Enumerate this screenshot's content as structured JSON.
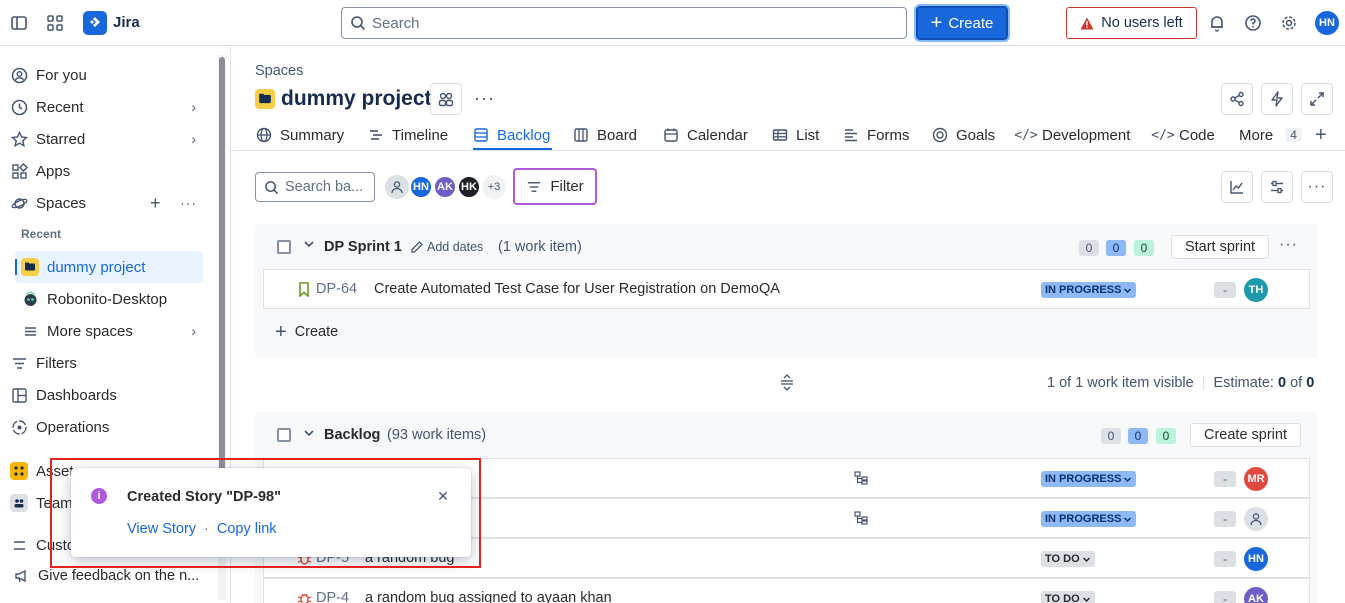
{
  "topbar": {
    "app_name": "Jira",
    "search_placeholder": "Search",
    "create_label": "Create",
    "no_users_label": "No users left",
    "user_initials": "HN"
  },
  "sidebar": {
    "items": [
      {
        "label": "For you",
        "icon": "person-circle-icon"
      },
      {
        "label": "Recent",
        "icon": "clock-icon"
      },
      {
        "label": "Starred",
        "icon": "star-icon"
      },
      {
        "label": "Apps",
        "icon": "apps-icon"
      },
      {
        "label": "Spaces",
        "icon": "planet-icon"
      },
      {
        "label": "Filters",
        "icon": "filter-icon"
      },
      {
        "label": "Dashboards",
        "icon": "dashboard-icon"
      },
      {
        "label": "Operations",
        "icon": "operations-icon"
      }
    ],
    "recent_label": "Recent",
    "recent_spaces": [
      {
        "label": "dummy project"
      },
      {
        "label": "Robonito-Desktop"
      },
      {
        "label": "More spaces"
      }
    ],
    "partial_items": [
      "Asset",
      "Team",
      "Custo"
    ],
    "feedback_label": "Give feedback on the n..."
  },
  "main": {
    "breadcrumb": "Spaces",
    "project_title": "dummy project",
    "tabs": [
      {
        "label": "Summary"
      },
      {
        "label": "Timeline"
      },
      {
        "label": "Backlog"
      },
      {
        "label": "Board"
      },
      {
        "label": "Calendar"
      },
      {
        "label": "List"
      },
      {
        "label": "Forms"
      },
      {
        "label": "Goals"
      },
      {
        "label": "Development"
      },
      {
        "label": "Code"
      },
      {
        "label": "More"
      }
    ],
    "more_count": "4",
    "backlog_search_placeholder": "Search ba...",
    "avatars": [
      {
        "initials": "HN",
        "color": "#1868db"
      },
      {
        "initials": "AK",
        "color": "#6e5dc6"
      },
      {
        "initials": "HK",
        "color": "#1d2125"
      }
    ],
    "avatars_extra": "+3",
    "filter_label": "Filter"
  },
  "sprint": {
    "title": "DP Sprint 1",
    "add_dates": "Add dates",
    "count": "(1 work item)",
    "counts": [
      "0",
      "0",
      "0"
    ],
    "start_button": "Start sprint",
    "items": [
      {
        "key": "DP-64",
        "summary": "Create Automated Test Case for User Registration on DemoQA",
        "status": "IN PROGRESS",
        "estimate": "-",
        "assignee": "TH",
        "assignee_color": "#1d9aaa"
      }
    ],
    "create_label": "Create",
    "visible_text": "1 of 1 work item visible",
    "estimate_label": "Estimate:",
    "estimate_done": "0",
    "estimate_of": "of",
    "estimate_total": "0"
  },
  "backlog": {
    "title": "Backlog",
    "count": "(93 work items)",
    "counts": [
      "0",
      "0",
      "0"
    ],
    "create_sprint_button": "Create sprint",
    "items": [
      {
        "key": "",
        "summary": "",
        "status": "IN PROGRESS",
        "estimate": "-",
        "assignee": "MR",
        "assignee_color": "#e2483d"
      },
      {
        "key": "",
        "summary": "",
        "status": "IN PROGRESS",
        "estimate": "-",
        "assignee": "",
        "assignee_color": "#dcdfe4"
      },
      {
        "key": "DP-5",
        "summary": "a random bug",
        "status": "TO DO",
        "estimate": "-",
        "assignee": "HN",
        "assignee_color": "#1868db"
      },
      {
        "key": "DP-4",
        "summary": "a random bug assigned to ayaan khan",
        "status": "TO DO",
        "estimate": "-",
        "assignee": "AK",
        "assignee_color": "#6e5dc6"
      }
    ]
  },
  "toast": {
    "title": "Created Story \"DP-98\"",
    "view_link": "View Story",
    "separator": "·",
    "copy_link": "Copy link"
  }
}
